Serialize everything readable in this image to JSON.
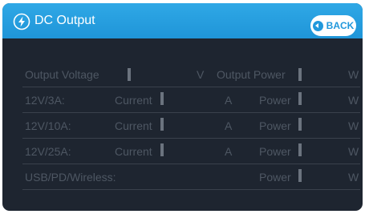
{
  "header": {
    "title": "DC Output",
    "back_label": "BACK"
  },
  "rows": [
    {
      "label": "Output Voltage",
      "unit1": "V",
      "label2": "Output Power",
      "unit2": "W"
    },
    {
      "label": "12V/3A:",
      "label1": "Current",
      "unit1": "A",
      "label2": "Power",
      "unit2": "W"
    },
    {
      "label": "12V/10A:",
      "label1": "Current",
      "unit1": "A",
      "label2": "Power",
      "unit2": "W"
    },
    {
      "label": "12V/25A:",
      "label1": "Current",
      "unit1": "A",
      "label2": "Power",
      "unit2": "W"
    },
    {
      "label": "USB/PD/Wireless:",
      "label2": "Power",
      "unit2": "W"
    }
  ],
  "colors": {
    "header": "#1f95d8",
    "background": "#1e2530",
    "text": "#4e5763"
  },
  "icons": [
    "bolt-circle-icon",
    "back-arrow-icon"
  ]
}
